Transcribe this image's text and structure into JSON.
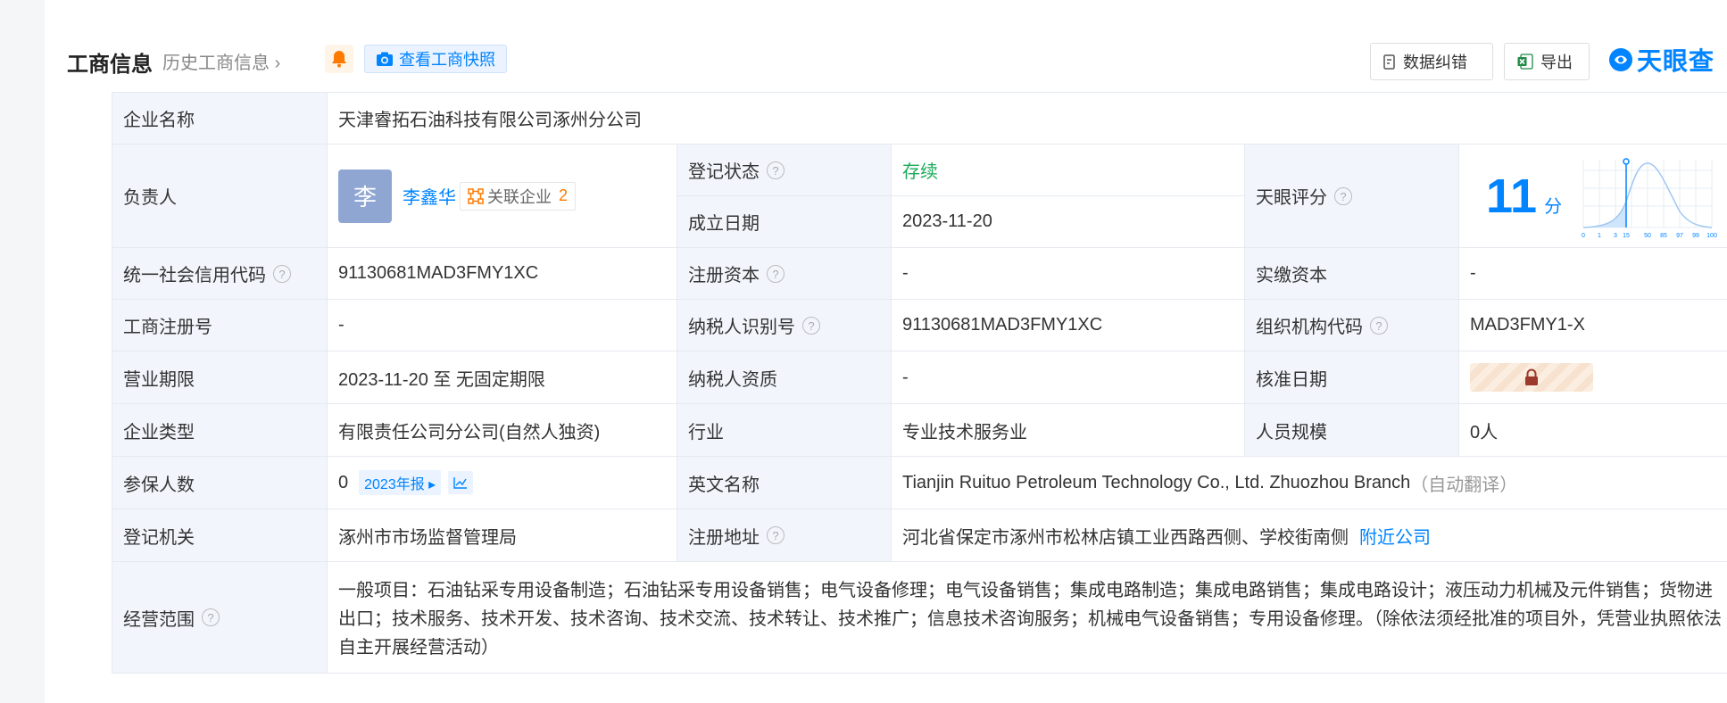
{
  "header": {
    "title": "工商信息",
    "history_link": "历史工商信息",
    "snapshot_button": "查看工商快照",
    "correct_button": "数据纠错",
    "export_button": "导出",
    "logo_text": "天眼查"
  },
  "rows": {
    "company_name_label": "企业名称",
    "company_name": "天津睿拓石油科技有限公司涿州分公司",
    "leader_label": "负责人",
    "leader_avatar": "李",
    "leader_name": "李鑫华",
    "related_label": "关联企业",
    "related_count": "2",
    "reg_status_label": "登记状态",
    "reg_status": "存续",
    "est_date_label": "成立日期",
    "est_date": "2023-11-20",
    "tianyan_score_label": "天眼评分",
    "tianyan_score": "11",
    "tianyan_score_unit": "分",
    "score_ticks": [
      "0",
      "1",
      "3",
      "15",
      "50",
      "85",
      "97",
      "99",
      "100"
    ],
    "credit_code_label": "统一社会信用代码",
    "credit_code": "91130681MAD3FMY1XC",
    "reg_capital_label": "注册资本",
    "reg_capital": "-",
    "paid_capital_label": "实缴资本",
    "paid_capital": "-",
    "biz_reg_no_label": "工商注册号",
    "biz_reg_no": "-",
    "taxpayer_id_label": "纳税人识别号",
    "taxpayer_id": "91130681MAD3FMY1XC",
    "org_code_label": "组织机构代码",
    "org_code": "MAD3FMY1-X",
    "term_label": "营业期限",
    "term": "2023-11-20 至 无固定期限",
    "tax_qual_label": "纳税人资质",
    "tax_qual": "-",
    "approve_date_label": "核准日期",
    "type_label": "企业类型",
    "type": "有限责任公司分公司(自然人独资)",
    "industry_label": "行业",
    "industry": "专业技术服务业",
    "staff_label": "人员规模",
    "staff": "0人",
    "insured_label": "参保人数",
    "insured": "0",
    "insured_year": "2023年报",
    "english_name_label": "英文名称",
    "english_name": "Tianjin Ruituo Petroleum Technology Co., Ltd. Zhuozhou Branch",
    "auto_translate": "（自动翻译）",
    "authority_label": "登记机关",
    "authority": "涿州市市场监督管理局",
    "address_label": "注册地址",
    "address": "河北省保定市涿州市松林店镇工业西路西侧、学校街南侧",
    "nearby_link": "附近公司",
    "scope_label": "经营范围",
    "scope": "一般项目：石油钻采专用设备制造；石油钻采专用设备销售；电气设备修理；电气设备销售；集成电路制造；集成电路销售；集成电路设计；液压动力机械及元件销售；货物进出口；技术服务、技术开发、技术咨询、技术交流、技术转让、技术推广；信息技术咨询服务；机械电气设备销售；专用设备修理。（除依法须经批准的项目外，凭营业执照依法自主开展经营活动）"
  },
  "colors": {
    "accent": "#0084ff",
    "status_green": "#1aab5a",
    "label_bg": "#f2f6fc",
    "related_orange": "#ff7a00"
  }
}
